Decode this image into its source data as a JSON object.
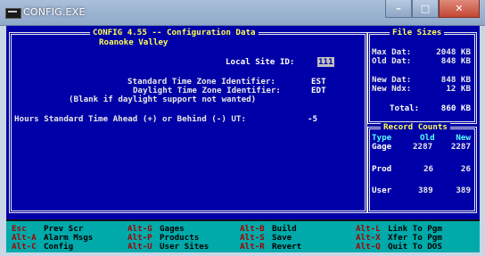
{
  "window": {
    "title": "CONFIG.EXE",
    "min_label": "–",
    "max_label": "□",
    "close_label": "✕"
  },
  "config": {
    "title": "CONFIG 4.55 -- Configuration Data",
    "subtitle": "Roanoke Valley",
    "site_label": "Local Site ID:",
    "site_value": "111",
    "std_label": "Standard Time Zone Identifier:",
    "std_value": "EST",
    "dst_label": "Daylight Time Zone Identifier:",
    "dst_value": "EDT",
    "blank_note": "(Blank if daylight support not wanted)",
    "offset_label": "Hours Standard Time Ahead (+) or Behind (-) UT:",
    "offset_value": "-5"
  },
  "file_sizes": {
    "title": "File Sizes",
    "rows": [
      {
        "label": "Max Dat:",
        "value": "2048 KB"
      },
      {
        "label": "Old Dat:",
        "value": "848 KB"
      },
      {
        "label": "New Dat:",
        "value": "848 KB"
      },
      {
        "label": "New Ndx:",
        "value": "12 KB"
      }
    ],
    "total_label": "Total:",
    "total_value": "860 KB"
  },
  "record_counts": {
    "title": "Record Counts",
    "headers": [
      "Type",
      "Old",
      "New"
    ],
    "rows": [
      {
        "type": "Gage",
        "old": "2287",
        "new": "2287"
      },
      {
        "type": "Prod",
        "old": "26",
        "new": "26"
      },
      {
        "type": "User",
        "old": "389",
        "new": "389"
      }
    ]
  },
  "hotkeys": [
    {
      "key": "Esc",
      "desc": "Prev Scr"
    },
    {
      "key": "Alt-A",
      "desc": "Alarm Msgs"
    },
    {
      "key": "Alt-C",
      "desc": "Config"
    },
    {
      "key": "Alt-G",
      "desc": "Gages"
    },
    {
      "key": "Alt-P",
      "desc": "Products"
    },
    {
      "key": "Alt-U",
      "desc": "User Sites"
    },
    {
      "key": "Alt-B",
      "desc": "Build"
    },
    {
      "key": "Alt-S",
      "desc": "Save"
    },
    {
      "key": "Alt-R",
      "desc": "Revert"
    },
    {
      "key": "Alt-L",
      "desc": "Link To Pgm"
    },
    {
      "key": "Alt-X",
      "desc": "Xfer To Pgm"
    },
    {
      "key": "Alt-Q",
      "desc": "Quit To DOS"
    }
  ]
}
